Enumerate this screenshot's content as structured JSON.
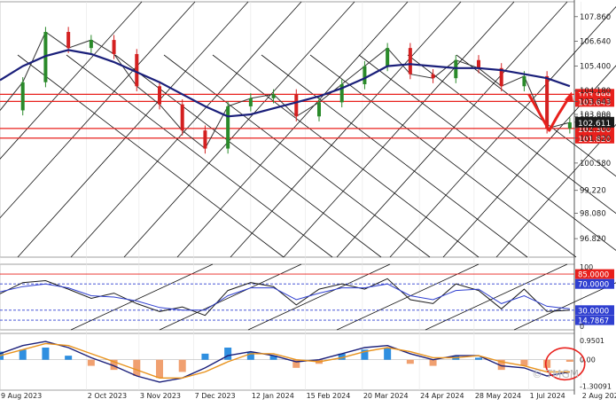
{
  "chart_data": [
    {
      "panel": "price",
      "type": "candlestick",
      "title": "",
      "ylim": [
        95.9,
        108.6
      ],
      "y_ticks": [
        "107.860",
        "106.640",
        "105.400",
        "104.180",
        "103.643",
        "103.000",
        "102.900",
        "102.611",
        "102.300",
        "101.820",
        "100.580",
        "99.220",
        "98.080",
        "96.820"
      ],
      "last_price": "102.611",
      "levels": [
        {
          "label": "103.999",
          "value": 103.999,
          "color": "#e8201c"
        },
        {
          "label": "103.643",
          "value": 103.643,
          "color": "#e8201c"
        },
        {
          "label": "102.300",
          "value": 102.3,
          "color": "#e8201c"
        },
        {
          "label": "101.820",
          "value": 101.82,
          "color": "#e8201c"
        }
      ],
      "moving_average": {
        "color": "#1a1f7a",
        "x": [
          0,
          10,
          20,
          30,
          40,
          50,
          60,
          70,
          80,
          90,
          100,
          110,
          120,
          130,
          140,
          150,
          160,
          170,
          180,
          190,
          200,
          210,
          220,
          230,
          240,
          250
        ],
        "y": [
          104.7,
          105.4,
          105.9,
          106.2,
          106.0,
          105.6,
          105.1,
          104.6,
          104.0,
          103.4,
          102.9,
          103.0,
          103.3,
          103.6,
          103.9,
          104.3,
          104.8,
          105.4,
          105.5,
          105.4,
          105.3,
          105.3,
          105.2,
          105.0,
          104.8,
          104.4
        ]
      },
      "price_series": {
        "x": [
          0,
          10,
          20,
          30,
          40,
          50,
          60,
          70,
          80,
          90,
          100,
          110,
          120,
          130,
          140,
          150,
          160,
          170,
          180,
          190,
          200,
          210,
          220,
          230,
          240,
          250
        ],
        "y": [
          103.2,
          104.6,
          107.1,
          106.3,
          106.7,
          106.0,
          104.4,
          103.5,
          102.2,
          101.3,
          103.4,
          103.8,
          104.0,
          102.9,
          103.6,
          104.5,
          105.4,
          106.3,
          105.0,
          104.8,
          105.7,
          105.3,
          104.4,
          104.9,
          102.3,
          102.6
        ]
      },
      "forecast_arrow": {
        "color": "#e8201c",
        "x": [
          232,
          236,
          241,
          245,
          250
        ],
        "y": [
          104.0,
          103.2,
          102.2,
          103.0,
          103.9
        ]
      }
    },
    {
      "panel": "rsi",
      "type": "line",
      "ylim": [
        0,
        100
      ],
      "levels": [
        {
          "label": "85.0000",
          "value": 85,
          "color": "#e8201c"
        },
        {
          "label": "70.0000",
          "value": 70,
          "color": "#2f3fd0"
        },
        {
          "label": "30.0000",
          "value": 30,
          "color": "#2f3fd0"
        },
        {
          "label": "14.7867",
          "value": 14.7867,
          "color": "#2f3fd0"
        }
      ],
      "axis_labels": [
        "100",
        "0"
      ],
      "series": [
        {
          "color": "#1a1a1a",
          "x": [
            0,
            10,
            20,
            30,
            40,
            50,
            60,
            70,
            80,
            90,
            100,
            110,
            120,
            130,
            140,
            150,
            160,
            170,
            180,
            190,
            200,
            210,
            220,
            230,
            240,
            250
          ],
          "y": [
            55,
            72,
            75,
            62,
            48,
            56,
            40,
            28,
            35,
            22,
            60,
            72,
            66,
            38,
            62,
            70,
            62,
            78,
            46,
            40,
            70,
            60,
            32,
            62,
            28,
            30
          ]
        },
        {
          "color": "#2f3fd0",
          "x": [
            0,
            10,
            20,
            30,
            40,
            50,
            60,
            70,
            80,
            90,
            100,
            110,
            120,
            130,
            140,
            150,
            160,
            170,
            180,
            190,
            200,
            210,
            220,
            230,
            240,
            250
          ],
          "y": [
            58,
            66,
            70,
            64,
            52,
            50,
            44,
            34,
            30,
            30,
            52,
            64,
            64,
            46,
            56,
            64,
            64,
            70,
            52,
            46,
            60,
            62,
            40,
            52,
            36,
            32
          ]
        }
      ]
    },
    {
      "panel": "macd",
      "type": "bar",
      "ylim": [
        -1.5,
        1.3
      ],
      "axis_labels": [
        "0.9501",
        "0.00",
        "-1.30091"
      ],
      "signal_color": "#e8921c",
      "macd_color": "#1a1f7a",
      "x": [
        0,
        10,
        20,
        30,
        40,
        50,
        60,
        70,
        80,
        90,
        100,
        110,
        120,
        130,
        140,
        150,
        160,
        170,
        180,
        190,
        200,
        210,
        220,
        230,
        240,
        250
      ],
      "histogram": [
        0.4,
        0.5,
        0.6,
        0.2,
        -0.3,
        -0.5,
        -0.8,
        -0.9,
        -0.6,
        0.3,
        0.6,
        0.4,
        0.2,
        -0.4,
        -0.2,
        0.3,
        0.5,
        0.6,
        -0.2,
        -0.3,
        0.2,
        0.1,
        -0.5,
        -0.3,
        -0.4,
        -0.1
      ],
      "macd": [
        0.3,
        0.7,
        0.9,
        0.6,
        0.1,
        -0.3,
        -0.8,
        -1.1,
        -0.9,
        -0.4,
        0.2,
        0.4,
        0.2,
        -0.1,
        0.0,
        0.3,
        0.6,
        0.7,
        0.3,
        0.0,
        0.2,
        0.2,
        -0.3,
        -0.4,
        -0.8,
        -0.6
      ],
      "signal": [
        0.2,
        0.5,
        0.8,
        0.7,
        0.3,
        -0.1,
        -0.5,
        -0.9,
        -0.9,
        -0.6,
        -0.1,
        0.3,
        0.3,
        0.0,
        -0.1,
        0.1,
        0.4,
        0.6,
        0.4,
        0.1,
        0.1,
        0.2,
        -0.1,
        -0.3,
        -0.6,
        -0.6
      ]
    }
  ],
  "x_axis": {
    "domain": [
      0,
      252
    ],
    "labels": [
      {
        "text": "9 Aug 2023",
        "x": 0
      },
      {
        "text": "2 Oct 2023",
        "x": 38
      },
      {
        "text": "3 Nov 2023",
        "x": 61
      },
      {
        "text": "7 Dec 2023",
        "x": 85
      },
      {
        "text": "12 Jan 2024",
        "x": 110
      },
      {
        "text": "15 Feb 2024",
        "x": 134
      },
      {
        "text": "20 Mar 2024",
        "x": 159
      },
      {
        "text": "24 Apr 2024",
        "x": 184
      },
      {
        "text": "28 May 2024",
        "x": 208
      },
      {
        "text": "1 Jul 2024",
        "x": 232
      },
      {
        "text": "2 Aug 2024",
        "x": 255
      }
    ]
  },
  "watermark": "© TMGM",
  "colors": {
    "level_red": "#e8201c",
    "ma_navy": "#1a1f7a",
    "hist_blue": "#2f8fe0",
    "hist_orange": "#f0a070",
    "grid": "#e6e6e6"
  }
}
